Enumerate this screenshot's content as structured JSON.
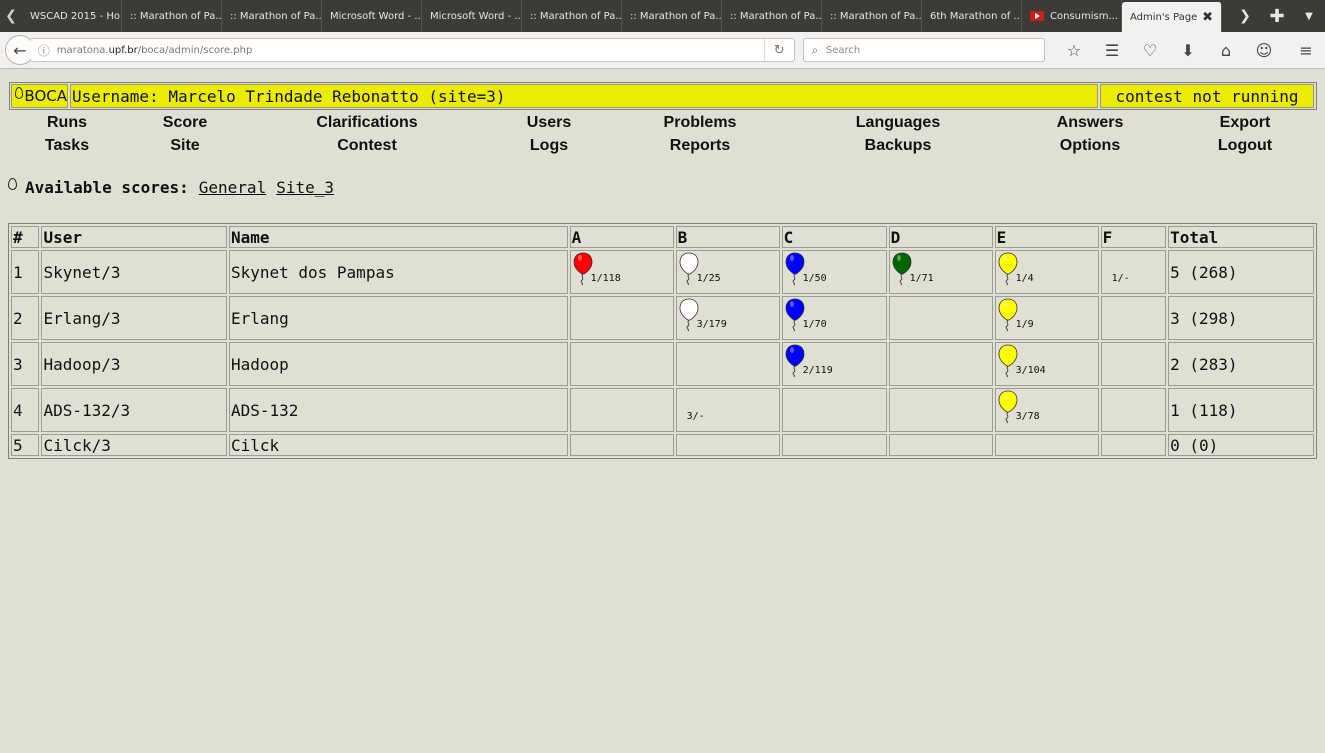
{
  "browser": {
    "tabs": [
      {
        "label": "WSCAD 2015 - Ho..."
      },
      {
        "label": ":: Marathon of Pa..."
      },
      {
        "label": ":: Marathon of Pa..."
      },
      {
        "label": "Microsoft Word - ..."
      },
      {
        "label": "Microsoft Word - ..."
      },
      {
        "label": ":: Marathon of Pa..."
      },
      {
        "label": ":: Marathon of Pa..."
      },
      {
        "label": ":: Marathon of Pa..."
      },
      {
        "label": ":: Marathon of Pa..."
      },
      {
        "label": "6th Marathon of ..."
      },
      {
        "label": "Consumism..."
      }
    ],
    "active_tab": "Admin's Page",
    "url_prefix": "maratona.",
    "url_domain": "upf.br",
    "url_path": "/boca/admin/score.php",
    "search_placeholder": "Search"
  },
  "header": {
    "logo": "BOCA",
    "username": "Username: Marcelo Trindade Rebonatto (site=3)",
    "status": "contest not running"
  },
  "menu": {
    "row1": [
      "Runs",
      "Score",
      "Clarifications",
      "Users",
      "Problems",
      "Languages",
      "Answers",
      "Export"
    ],
    "row2": [
      "Tasks",
      "Site",
      "Contest",
      "Logs",
      "Reports",
      "Backups",
      "Options",
      "Logout"
    ]
  },
  "scores": {
    "label": "Available scores:",
    "links": [
      "General",
      "Site_3"
    ]
  },
  "table": {
    "headers": [
      "#",
      "User",
      "Name",
      "A",
      "B",
      "C",
      "D",
      "E",
      "F",
      "Total"
    ],
    "problem_colors": {
      "A": "#ff0000",
      "B": "#ffffff",
      "C": "#0000ff",
      "D": "#006600",
      "E": "#ffff00",
      "F": "#ffffff"
    },
    "rows": [
      {
        "rank": "1",
        "user": "Skynet/3",
        "name": "Skynet dos Pampas",
        "cells": {
          "A": {
            "balloon": true,
            "text": "1/118"
          },
          "B": {
            "balloon": true,
            "text": "1/25"
          },
          "C": {
            "balloon": true,
            "text": "1/50"
          },
          "D": {
            "balloon": true,
            "text": "1/71"
          },
          "E": {
            "balloon": true,
            "text": "1/4"
          },
          "F": {
            "balloon": false,
            "text": "1/-"
          }
        },
        "total": "5 (268)"
      },
      {
        "rank": "2",
        "user": "Erlang/3",
        "name": "Erlang",
        "cells": {
          "B": {
            "balloon": true,
            "text": "3/179"
          },
          "C": {
            "balloon": true,
            "text": "1/70"
          },
          "E": {
            "balloon": true,
            "text": "1/9"
          }
        },
        "total": "3 (298)"
      },
      {
        "rank": "3",
        "user": "Hadoop/3",
        "name": "Hadoop",
        "cells": {
          "C": {
            "balloon": true,
            "text": "2/119"
          },
          "E": {
            "balloon": true,
            "text": "3/104"
          }
        },
        "total": "2 (283)"
      },
      {
        "rank": "4",
        "user": "ADS-132/3",
        "name": "ADS-132",
        "cells": {
          "B": {
            "balloon": false,
            "text": "3/-"
          },
          "E": {
            "balloon": true,
            "text": "3/78"
          }
        },
        "total": "1 (118)"
      },
      {
        "rank": "5",
        "user": "Cilck/3",
        "name": "Cilck",
        "cells": {},
        "total": "0 (0)"
      }
    ]
  }
}
